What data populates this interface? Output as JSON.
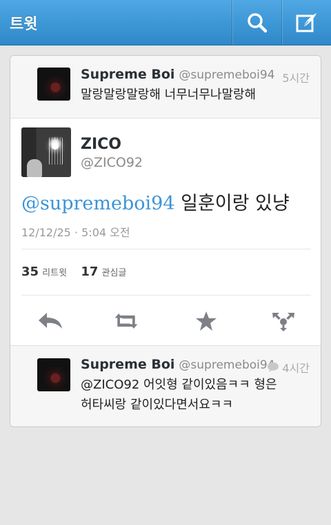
{
  "header": {
    "title": "트윗",
    "search_icon": "search-icon",
    "compose_icon": "compose-icon",
    "bar_color": "#3a95d6"
  },
  "reply_top": {
    "name": "Supreme Boi",
    "handle": "@supremeboi94",
    "time": "5시간",
    "text": "말랑말랑말랑해 너무너무나말랑해"
  },
  "main_tweet": {
    "name": "ZICO",
    "handle": "@ZICO92",
    "mention": "@supremeboi94",
    "text": " 일훈이랑 있냥",
    "timestamp": "12/12/25 · 5:04 오전",
    "retweet_count": "35",
    "retweet_label": "리트윗",
    "favorite_count": "17",
    "favorite_label": "관심글"
  },
  "actions": [
    "reply-icon",
    "retweet-icon",
    "favorite-icon",
    "more-icon"
  ],
  "reply_bottom": {
    "name": "Supreme Boi",
    "handle": "@supremeboi94",
    "time": "4시간",
    "text_line1": "@ZICO92 어잇형 같이있음ㅋㅋ 형은",
    "text_line2": "허타씨랑 같이있다면서요ㅋㅋ"
  },
  "colors": {
    "mention": "#3b94d9",
    "action_icon": "#7d8186"
  }
}
